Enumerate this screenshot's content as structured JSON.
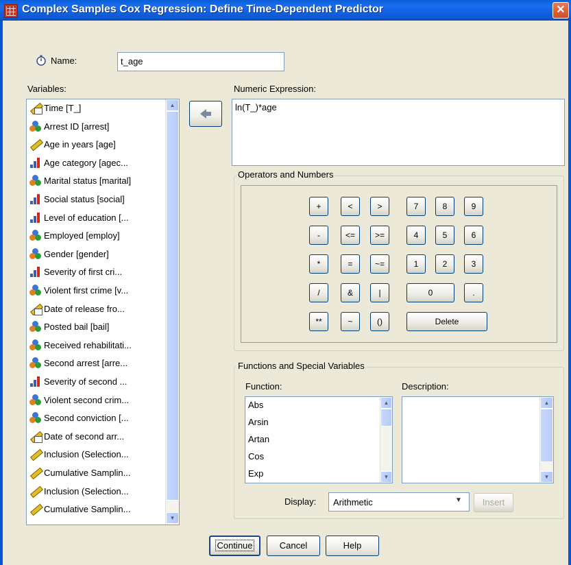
{
  "window": {
    "title": "Complex Samples Cox Regression: Define Time-Dependent Predictor",
    "close_glyph": "✕"
  },
  "name": {
    "label": "Name:",
    "value": "t_age"
  },
  "variables": {
    "label": "Variables:",
    "items": [
      {
        "label": "Time [T_]",
        "icon": "date-ruler-icon"
      },
      {
        "label": "Arrest ID [arrest]",
        "icon": "nominal-icon"
      },
      {
        "label": "Age in years [age]",
        "icon": "scale-icon"
      },
      {
        "label": "Age category [agec...",
        "icon": "ordinal-icon"
      },
      {
        "label": "Marital status [marital]",
        "icon": "nominal-icon"
      },
      {
        "label": "Social status [social]",
        "icon": "ordinal-icon"
      },
      {
        "label": "Level of education [...",
        "icon": "ordinal-icon"
      },
      {
        "label": "Employed [employ]",
        "icon": "nominal-icon"
      },
      {
        "label": "Gender [gender]",
        "icon": "nominal-icon"
      },
      {
        "label": "Severity of first cri...",
        "icon": "ordinal-icon"
      },
      {
        "label": "Violent first crime [v...",
        "icon": "nominal-icon"
      },
      {
        "label": "Date of release fro...",
        "icon": "date-ruler-icon"
      },
      {
        "label": "Posted bail [bail]",
        "icon": "nominal-icon"
      },
      {
        "label": "Received rehabilitati...",
        "icon": "nominal-icon"
      },
      {
        "label": "Second arrest [arre...",
        "icon": "nominal-icon"
      },
      {
        "label": "Severity of second ...",
        "icon": "ordinal-icon"
      },
      {
        "label": "Violent second crim...",
        "icon": "nominal-icon"
      },
      {
        "label": "Second conviction [...",
        "icon": "nominal-icon"
      },
      {
        "label": "Date of second arr...",
        "icon": "date-ruler-icon"
      },
      {
        "label": "Inclusion (Selection...",
        "icon": "scale-icon"
      },
      {
        "label": "Cumulative Samplin...",
        "icon": "scale-icon"
      },
      {
        "label": "Inclusion (Selection...",
        "icon": "scale-icon"
      },
      {
        "label": "Cumulative Samplin...",
        "icon": "scale-icon"
      }
    ]
  },
  "move_button": {
    "icon": "arrow-right-icon"
  },
  "expression": {
    "label": "Numeric Expression:",
    "value": "ln(T_)*age"
  },
  "operators": {
    "title": "Operators and Numbers",
    "keys": {
      "plus": "+",
      "lt": "<",
      "gt": ">",
      "n7": "7",
      "n8": "8",
      "n9": "9",
      "minus": "-",
      "le": "<=",
      "ge": ">=",
      "n4": "4",
      "n5": "5",
      "n6": "6",
      "times": "*",
      "eq": "=",
      "ne": "~=",
      "n1": "1",
      "n2": "2",
      "n3": "3",
      "div": "/",
      "and": "&",
      "or": "|",
      "n0": "0",
      "dot": ".",
      "pow": "**",
      "not": "~",
      "paren": "()",
      "delete": "Delete"
    }
  },
  "functions": {
    "title": "Functions and Special Variables",
    "function_label": "Function:",
    "description_label": "Description:",
    "items": [
      "Abs",
      "Arsin",
      "Artan",
      "Cos",
      "Exp"
    ],
    "description": ""
  },
  "display": {
    "label": "Display:",
    "value": "Arithmetic",
    "insert_label": "Insert"
  },
  "footer": {
    "continue": "Continue",
    "cancel": "Cancel",
    "help": "Help"
  }
}
